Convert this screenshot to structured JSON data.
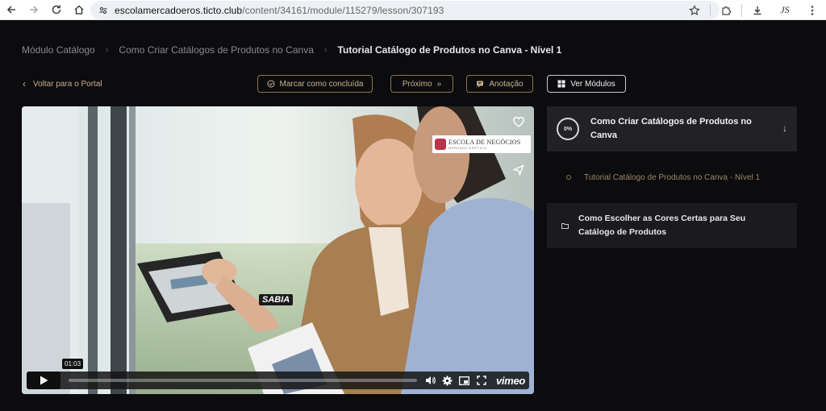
{
  "browser": {
    "url_domain": "escolamercadoeros.ticto.club",
    "url_path": "/content/34161/module/115279/lesson/307193",
    "profile_label": "JS"
  },
  "breadcrumb": {
    "items": [
      "Módulo Catálogo",
      "Como Criar Catálogos de Produtos no Canva",
      "Tutorial Catálogo de Produtos no Canva - Nível 1"
    ]
  },
  "nav": {
    "back_label": "Voltar para o Portal",
    "mark_done_label": "Marcar como concluída",
    "next_label": "Próximo",
    "note_label": "Anotação",
    "modules_label": "Ver Módulos"
  },
  "video": {
    "brand_name": "ESCOLA DE NEGÓCIOS",
    "brand_tag": "MERCADO ERÓTICO",
    "overlay_text": "SABIA",
    "time": "01:03",
    "progress": 0.0,
    "player_brand": "vimeo"
  },
  "sidebar": {
    "current_module": {
      "progress_label": "0%",
      "title": "Como Criar Catálogos de Produtos no Canva"
    },
    "lessons": [
      {
        "title": "Tutorial Catálogo de Produtos no Canva - Nível 1"
      }
    ],
    "next_module": {
      "title": "Como Escolher as Cores Certas para Seu Catálogo de Produtos"
    }
  },
  "colors": {
    "accent_gold": "#c9b48e",
    "background": "#0c0b0e",
    "panel": "#222125"
  }
}
